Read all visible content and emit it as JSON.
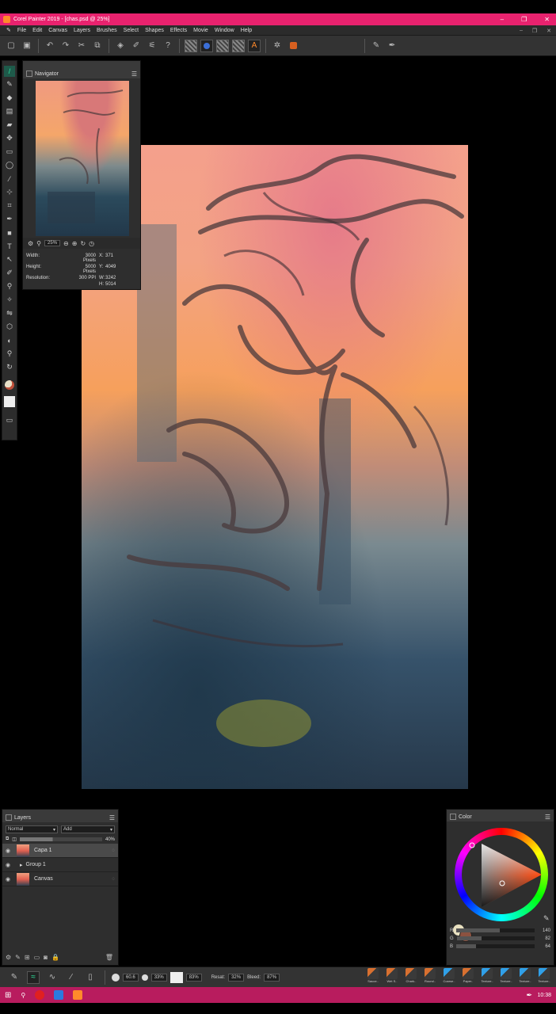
{
  "window": {
    "title": "Corel Painter 2019 - [chas.psd @ 25%]",
    "min": "–",
    "max": "❐",
    "close": "✕"
  },
  "menu": [
    "File",
    "Edit",
    "Canvas",
    "Layers",
    "Brushes",
    "Select",
    "Shapes",
    "Effects",
    "Movie",
    "Window",
    "Help"
  ],
  "menu_right": {
    "min": "–",
    "max": "❐",
    "close": "✕"
  },
  "navigator": {
    "title": "Navigator",
    "zoom": "25%",
    "width_label": "Width:",
    "width_value": "3000 Pixels",
    "height_label": "Height:",
    "height_value": "5000 Pixels",
    "resolution_label": "Resolution:",
    "resolution_value": "300 PPI",
    "x_label": "X:",
    "x_value": "371",
    "y_label": "Y:",
    "y_value": "4049",
    "w_label": "W:",
    "w_value": "3242",
    "h_label": "H:",
    "h_value": "5014"
  },
  "layers": {
    "title": "Layers",
    "composite_method": "Normal",
    "composite_depth": "Add",
    "opacity": "40%",
    "items": [
      {
        "name": "Capa 1",
        "selected": true
      },
      {
        "name": "Group 1",
        "selected": false
      },
      {
        "name": "Canvas",
        "selected": false
      }
    ]
  },
  "color": {
    "title": "Color",
    "r_label": "R",
    "r_value": "140",
    "g_label": "G",
    "g_value": "82",
    "b_label": "B",
    "b_value": "64",
    "r": 140,
    "g": 82,
    "b": 64,
    "main_hex": "#8c5240",
    "additional_hex": "#e8e0c0"
  },
  "propbar": {
    "size": "60.6",
    "opacity": "33%",
    "grain": "83%",
    "resat_label": "Resat:",
    "resat_value": "32%",
    "bleed_label": "Bleed:",
    "bleed_value": "87%"
  },
  "brushes": [
    "Sauce..",
    "Wet S..",
    "Chark..",
    "Round..",
    "Coarse..",
    "Paper..",
    "Texture..",
    "Texture..",
    "Texture..",
    "Texture.."
  ],
  "taskbar": {
    "time": "10:38"
  },
  "colors": {
    "titlebar": "#e8226e",
    "taskbar": "#b81c5e",
    "accent": "#2ee6a0"
  }
}
